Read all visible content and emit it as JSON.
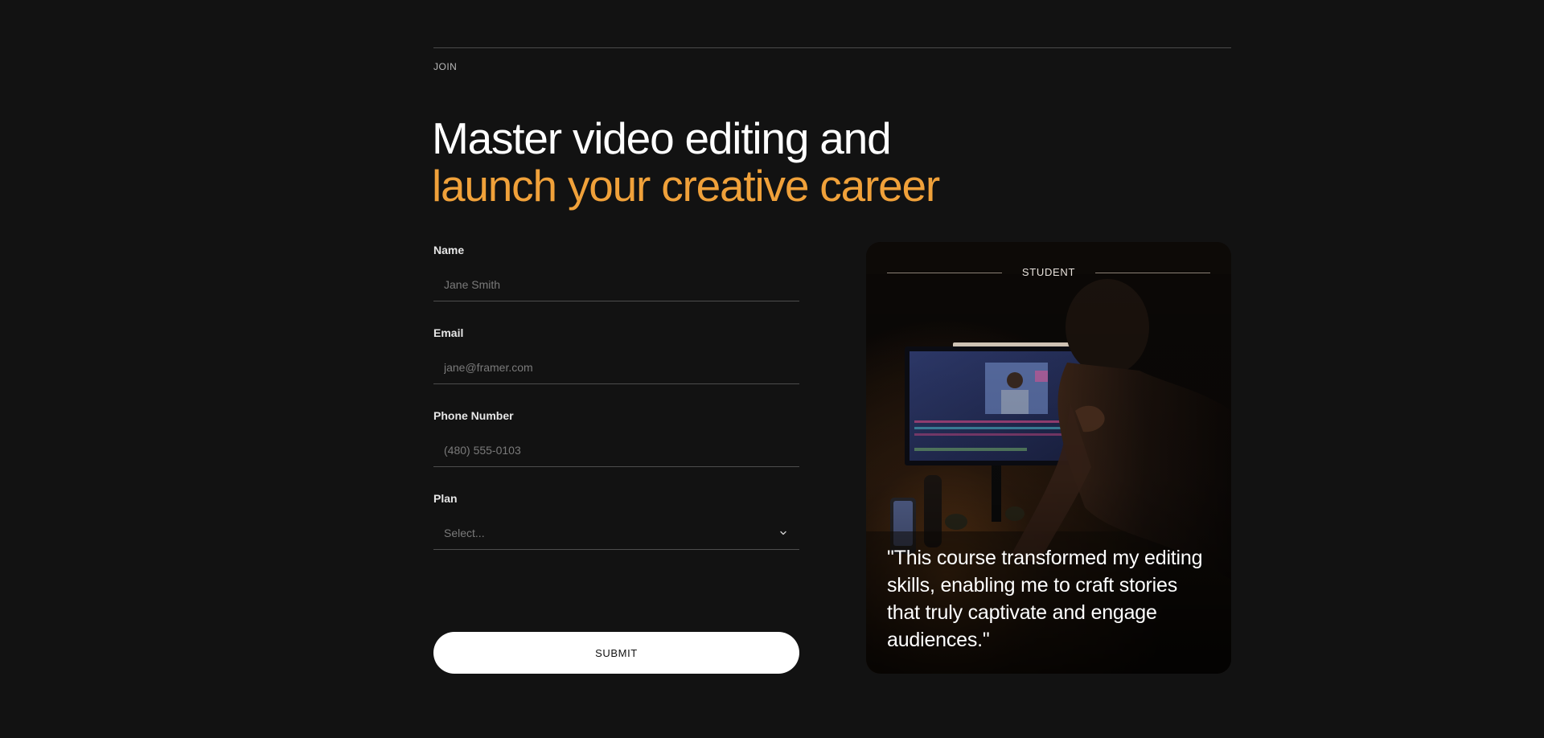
{
  "section": {
    "eyebrow": "JOIN",
    "headline_line1": "Master video editing and",
    "headline_line2": "launch your creative career"
  },
  "form": {
    "name": {
      "label": "Name",
      "placeholder": "Jane Smith"
    },
    "email": {
      "label": "Email",
      "placeholder": "jane@framer.com"
    },
    "phone": {
      "label": "Phone Number",
      "placeholder": "(480) 555-0103"
    },
    "plan": {
      "label": "Plan",
      "placeholder": "Select..."
    },
    "submit_label": "SUBMIT"
  },
  "testimonial": {
    "tag": "STUDENT",
    "quote": "\"This course transformed my editing skills, enabling me to craft stories that truly captivate and engage audiences.\""
  },
  "colors": {
    "background": "#121212",
    "accent": "#f0a13a",
    "button": "#ffffff"
  },
  "icons": {
    "select": "chevron-down-icon"
  }
}
